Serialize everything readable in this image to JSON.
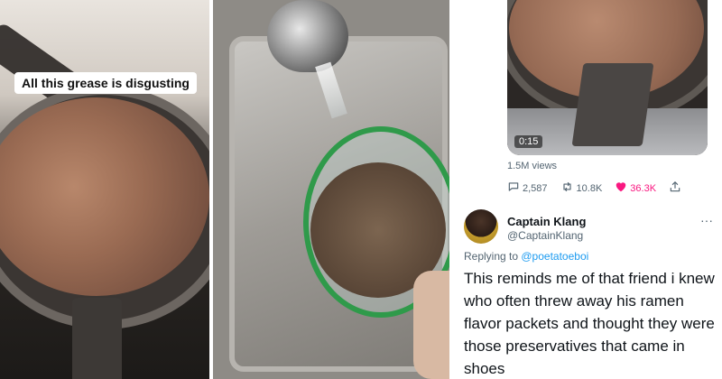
{
  "panel1": {
    "caption": "All this grease is disgusting"
  },
  "tweet": {
    "video_timer": "0:15",
    "views": "1.5M views",
    "stats": {
      "replies": "2,587",
      "retweets": "10.8K",
      "likes": "36.3K"
    },
    "icons": {
      "reply": "reply-icon",
      "retweet": "retweet-icon",
      "like": "heart-icon",
      "share": "share-icon"
    },
    "colors": {
      "like": "#f91880",
      "link": "#1d9bf0"
    }
  },
  "reply": {
    "name": "Captain Klang",
    "handle": "@CaptainKlang",
    "replying_prefix": "Replying to",
    "replying_to": "@poetatoeboi",
    "more": "···",
    "text": "This reminds me of that friend i knew who often threw away his ramen flavor packets and thought they were those preservatives that came in shoes"
  }
}
